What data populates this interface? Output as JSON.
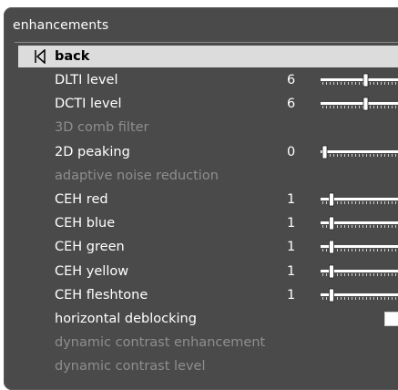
{
  "menu_title": "enhancements",
  "back_label": "back",
  "items": [
    {
      "label": "DLTI level",
      "value": "6",
      "level": 6,
      "control": "slider",
      "disabled": false
    },
    {
      "label": "DCTI level",
      "value": "6",
      "level": 6,
      "control": "slider",
      "disabled": false
    },
    {
      "label": "3D comb filter",
      "value": "",
      "control": "none",
      "disabled": true
    },
    {
      "label": "2D peaking",
      "value": "0",
      "level": 0,
      "control": "slider",
      "disabled": false
    },
    {
      "label": "adaptive noise reduction",
      "value": "",
      "control": "none",
      "disabled": true
    },
    {
      "label": "CEH red",
      "value": "1",
      "level": 1,
      "control": "slider",
      "disabled": false
    },
    {
      "label": "CEH blue",
      "value": "1",
      "level": 1,
      "control": "slider",
      "disabled": false
    },
    {
      "label": "CEH green",
      "value": "1",
      "level": 1,
      "control": "slider",
      "disabled": false
    },
    {
      "label": "CEH yellow",
      "value": "1",
      "level": 1,
      "control": "slider",
      "disabled": false
    },
    {
      "label": "CEH fleshtone",
      "value": "1",
      "level": 1,
      "control": "slider",
      "disabled": false
    },
    {
      "label": "horizontal deblocking",
      "value": "",
      "control": "checkbox",
      "checked": false,
      "disabled": false
    },
    {
      "label": "dynamic contrast enhancement",
      "value": "",
      "control": "none",
      "disabled": true
    },
    {
      "label": "dynamic contrast level",
      "value": "",
      "control": "none",
      "disabled": true
    }
  ],
  "colors": {
    "panel_bg": "#4a4a4a",
    "selected_bg": "#dcdcdc",
    "text_enabled": "#ffffff",
    "text_disabled": "#8e8e8e"
  }
}
